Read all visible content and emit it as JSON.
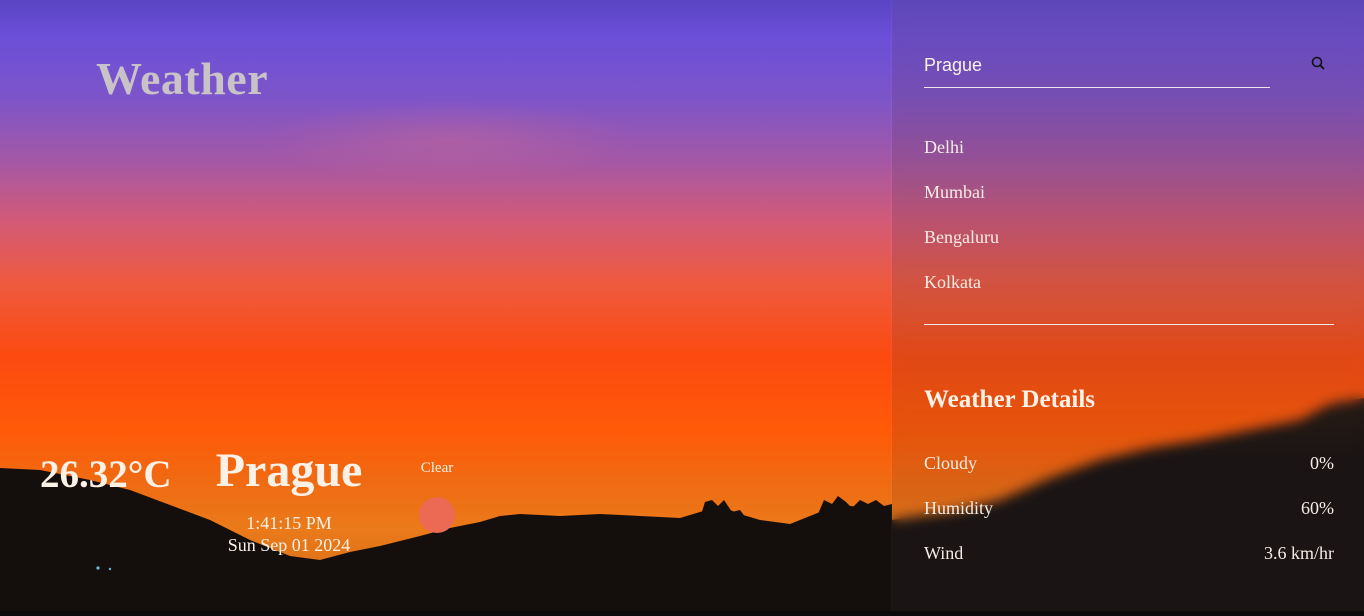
{
  "app": {
    "title": "Weather"
  },
  "current": {
    "temperature": "26.32°C",
    "city": "Prague",
    "time": "1:41:15 PM",
    "date": "Sun Sep 01 2024",
    "condition": "Clear",
    "condition_icon": "sun-icon"
  },
  "search": {
    "value": "Prague",
    "icon": "search-icon"
  },
  "cities": [
    {
      "label": "Delhi"
    },
    {
      "label": "Mumbai"
    },
    {
      "label": "Bengaluru"
    },
    {
      "label": "Kolkata"
    }
  ],
  "details": {
    "title": "Weather Details",
    "rows": [
      {
        "label": "Cloudy",
        "value": "0%"
      },
      {
        "label": "Humidity",
        "value": "60%"
      },
      {
        "label": "Wind",
        "value": "3.6 km/hr"
      }
    ]
  },
  "colors": {
    "sky_top": "#6b4fd8",
    "sky_bottom": "#fc4a10",
    "text": "#fbf1e6",
    "condition_icon": "#ec6a53"
  }
}
